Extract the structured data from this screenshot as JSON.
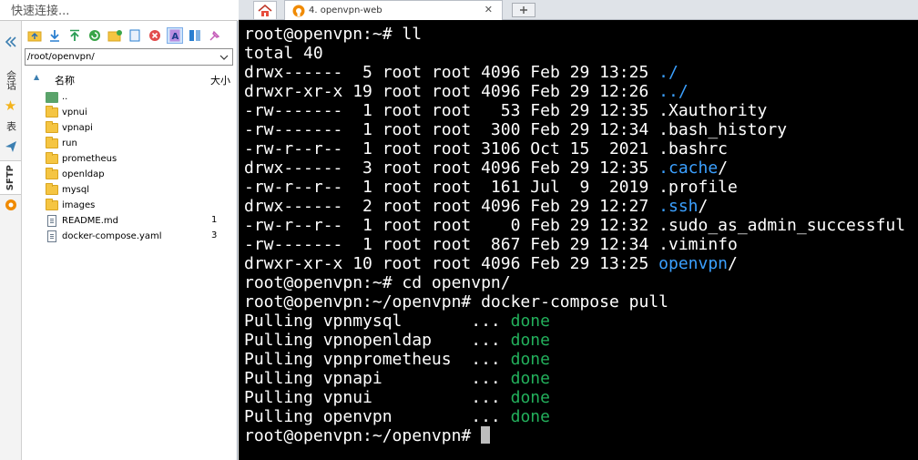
{
  "quick_connect": {
    "placeholder": "快速连接..."
  },
  "side_tabs": {
    "session": "会话",
    "star": "★",
    "filter": "表",
    "sftp": "SFTP"
  },
  "toolbar": {
    "icons": [
      "folder-up-icon",
      "download-icon",
      "upload-icon",
      "refresh-icon",
      "new-folder-icon",
      "new-file-icon",
      "delete-icon",
      "text-mode-icon",
      "binary-mode-icon",
      "pin-icon"
    ]
  },
  "path": {
    "value": "/root/openvpn/"
  },
  "file_header": {
    "name": "名称",
    "size": "大小"
  },
  "files": [
    {
      "name": "..",
      "type": "up",
      "size": ""
    },
    {
      "name": "vpnui",
      "type": "folder",
      "size": ""
    },
    {
      "name": "vpnapi",
      "type": "folder",
      "size": ""
    },
    {
      "name": "run",
      "type": "folder",
      "size": ""
    },
    {
      "name": "prometheus",
      "type": "folder",
      "size": ""
    },
    {
      "name": "openldap",
      "type": "folder",
      "size": ""
    },
    {
      "name": "mysql",
      "type": "folder",
      "size": ""
    },
    {
      "name": "images",
      "type": "folder",
      "size": ""
    },
    {
      "name": "README.md",
      "type": "file",
      "size": "1"
    },
    {
      "name": "docker-compose.yaml",
      "type": "file",
      "size": "3"
    }
  ],
  "tabs": {
    "home": "home-icon",
    "active": "4. openvpn-web",
    "close": "✕"
  },
  "colors": {
    "terminal_bg": "#000000",
    "dir_blue": "#3ba0ff",
    "done_green": "#23b05c"
  },
  "terminal": {
    "l1": "root@openvpn:~# ll",
    "l2": "total 40",
    "l3": {
      "meta": "drwx------  5 root root 4096 Feb 29 13:25 ",
      "name": "./"
    },
    "l4": {
      "meta": "drwxr-xr-x 19 root root 4096 Feb 29 12:26 ",
      "name": "../"
    },
    "l5": "-rw-------  1 root root   53 Feb 29 12:35 .Xauthority",
    "l6": "-rw-------  1 root root  300 Feb 29 12:34 .bash_history",
    "l7": "-rw-r--r--  1 root root 3106 Oct 15  2021 .bashrc",
    "l8": {
      "meta": "drwx------  3 root root 4096 Feb 29 12:35 ",
      "name": ".cache",
      "slash": "/"
    },
    "l9": "-rw-r--r--  1 root root  161 Jul  9  2019 .profile",
    "l10": {
      "meta": "drwx------  2 root root 4096 Feb 29 12:27 ",
      "name": ".ssh",
      "slash": "/"
    },
    "l11": "-rw-r--r--  1 root root    0 Feb 29 12:32 .sudo_as_admin_successful",
    "l12": "-rw-------  1 root root  867 Feb 29 12:34 .viminfo",
    "l13": {
      "meta": "drwxr-xr-x 10 root root 4096 Feb 29 13:25 ",
      "name": "openvpn",
      "slash": "/"
    },
    "l14": "root@openvpn:~# cd openvpn/",
    "l15": "root@openvpn:~/openvpn# docker-compose pull",
    "pulls": [
      {
        "text": "Pulling vpnmysql       ... ",
        "status": "done"
      },
      {
        "text": "Pulling vpnopenldap    ... ",
        "status": "done"
      },
      {
        "text": "Pulling vpnprometheus  ... ",
        "status": "done"
      },
      {
        "text": "Pulling vpnapi         ... ",
        "status": "done"
      },
      {
        "text": "Pulling vpnui          ... ",
        "status": "done"
      },
      {
        "text": "Pulling openvpn        ... ",
        "status": "done"
      }
    ],
    "prompt": "root@openvpn:~/openvpn# "
  }
}
